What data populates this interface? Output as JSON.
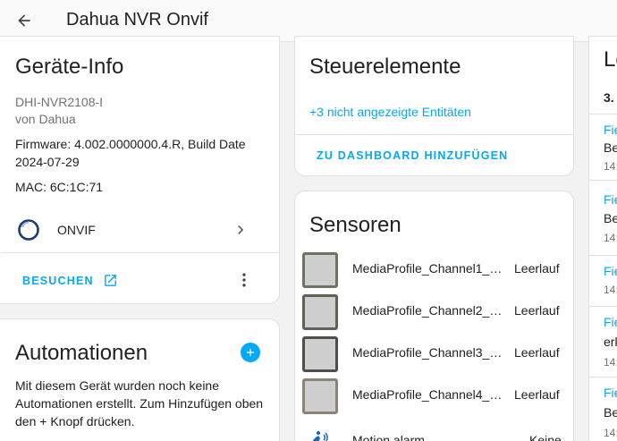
{
  "header": {
    "title": "Dahua NVR Onvif"
  },
  "device_info": {
    "title": "Geräte-Info",
    "model": "DHI-NVR2108-I",
    "manufacturer": "von Dahua",
    "firmware_line1": "Firmware: 4.002.0000000.4.R, Build Date",
    "firmware_line2": "2024-07-29",
    "mac": "MAC: 6C:1C:71",
    "integration": "ONVIF",
    "visit_label": "BESUCHEN"
  },
  "automations": {
    "title": "Automationen",
    "text_line1": "Mit diesem Gerät wurden noch keine",
    "text_line2": "Automationen erstellt. Zum Hinzufügen oben",
    "text_line3": "den + Knopf drücken."
  },
  "controls": {
    "title": "Steuerelemente",
    "hidden_entities": "+3 nicht angezeigte Entitäten",
    "add_to_dashboard": "ZU DASHBOARD HINZUFÜGEN"
  },
  "sensors": {
    "title": "Sensoren",
    "items": [
      {
        "name": "MediaProfile_Channel1_S...",
        "state": "Leerlauf"
      },
      {
        "name": "MediaProfile_Channel2_S...",
        "state": "Leerlauf"
      },
      {
        "name": "MediaProfile_Channel3_S...",
        "state": "Leerlauf"
      },
      {
        "name": "MediaProfile_Channel4_S...",
        "state": "Leerlauf"
      },
      {
        "name": "Motion alarm",
        "state": "Keine"
      }
    ]
  },
  "logbook": {
    "title": "Lo",
    "date": "3.",
    "entries": [
      {
        "a": "Fie",
        "b": "Be",
        "c": "14:"
      },
      {
        "a": "Fie",
        "b": "Be",
        "c": "14:"
      },
      {
        "a": "Fie",
        "b": "",
        "c": "14:"
      },
      {
        "a": "Fie",
        "b": "erk",
        "c": "14:"
      },
      {
        "a": "Fie",
        "b": "Be",
        "c": "14:"
      }
    ]
  },
  "colors": {
    "accent": "#03a9f4",
    "text": "#212121",
    "muted": "#727272",
    "background": "#f2f2f2"
  }
}
